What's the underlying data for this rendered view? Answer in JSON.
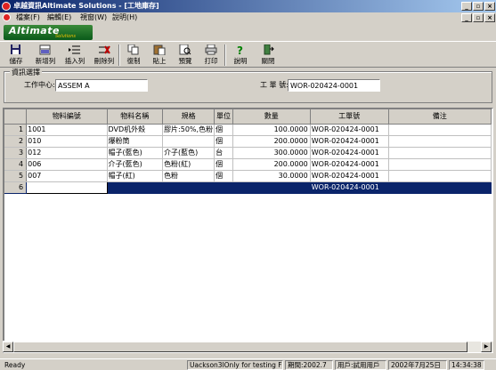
{
  "window": {
    "title": "卓越資訊Altimate Solutions - [工地庫存]"
  },
  "menu": [
    {
      "label": "檔案(F)"
    },
    {
      "label": "編輯(E)"
    },
    {
      "label": "視窗(W)"
    },
    {
      "label": "說明(H)"
    }
  ],
  "brand": {
    "logo_text": "Altimate",
    "logo_sub": "Solutions"
  },
  "toolbar": {
    "save": "儲存",
    "add_row": "新增列",
    "insert_row": "插入列",
    "delete_row": "刪除列",
    "copy": "復制",
    "paste": "貼上",
    "preview": "預覽",
    "print": "打印",
    "help": "說明",
    "close": "關閉"
  },
  "filter": {
    "group_title": "資訊選擇",
    "work_center_label": "工作中心:",
    "work_center_value": "ASSEM A",
    "work_order_label": "工 單 號:",
    "work_order_value": "WOR-020424-0001"
  },
  "grid": {
    "columns": [
      "物料編號",
      "物料名稱",
      "規格",
      "單位",
      "數量",
      "工單號",
      "備注"
    ],
    "rows": [
      {
        "n": "1",
        "code": "1001",
        "name": "DVD机外殼",
        "spec": "膠片:50%,色粉",
        "unit": "個",
        "qty": "100.0000",
        "wo": "WOR-020424-0001",
        "note": ""
      },
      {
        "n": "2",
        "code": "010",
        "name": "爆粉筒",
        "spec": "",
        "unit": "個",
        "qty": "200.0000",
        "wo": "WOR-020424-0001",
        "note": ""
      },
      {
        "n": "3",
        "code": "012",
        "name": "帽子(藍色)",
        "spec": "介子(藍色)",
        "unit": "台",
        "qty": "300.0000",
        "wo": "WOR-020424-0001",
        "note": ""
      },
      {
        "n": "4",
        "code": "006",
        "name": "介子(藍色)",
        "spec": "色粉(紅)",
        "unit": "個",
        "qty": "200.0000",
        "wo": "WOR-020424-0001",
        "note": ""
      },
      {
        "n": "5",
        "code": "007",
        "name": "帽子(紅)",
        "spec": "色粉",
        "unit": "個",
        "qty": "30.0000",
        "wo": "WOR-020424-0001",
        "note": ""
      },
      {
        "n": "6",
        "code": "",
        "name": "",
        "spec": "",
        "unit": "",
        "qty": "",
        "wo": "WOR-020424-0001",
        "note": ""
      }
    ]
  },
  "status": {
    "ready": "Ready",
    "user_info": "Uackson3lOnly for testing F",
    "period": "期間:2002.7",
    "user": "用戶:試用用戶",
    "date": "2002年7月25日",
    "time": "14:34:38"
  },
  "colors": {
    "title_active": "#0a246a",
    "selection": "#0a246a",
    "chrome": "#d4d0c8"
  }
}
